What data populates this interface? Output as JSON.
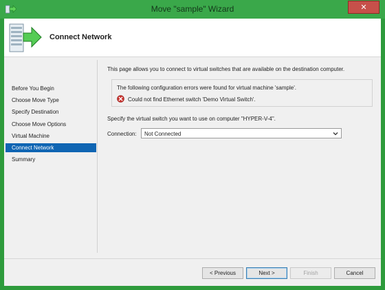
{
  "window": {
    "title": "Move \"sample\" Wizard",
    "close_label": "✕",
    "accent_color": "#3aa84a"
  },
  "header": {
    "title": "Connect Network",
    "icon": "wizard-server-arrow-icon"
  },
  "nav": {
    "items": [
      {
        "label": "Before You Begin",
        "active": false
      },
      {
        "label": "Choose Move Type",
        "active": false
      },
      {
        "label": "Specify Destination",
        "active": false
      },
      {
        "label": "Choose Move Options",
        "active": false
      },
      {
        "label": "Virtual Machine",
        "active": false
      },
      {
        "label": "Connect Network",
        "active": true
      },
      {
        "label": "Summary",
        "active": false
      }
    ],
    "selection_color": "#0f65b3"
  },
  "content": {
    "intro": "This page allows you to connect to virtual switches that are available on the destination computer.",
    "errors_heading": "The following configuration errors were found for virtual machine 'sample'.",
    "error_message": "Could not find Ethernet switch 'Demo Virtual Switch'.",
    "error_icon": "error-icon",
    "switch_prompt": "Specify the virtual switch you want to use on computer \"HYPER-V-4\".",
    "connection_label": "Connection:",
    "connection_value": "Not Connected"
  },
  "buttons": {
    "previous": "< Previous",
    "next": "Next >",
    "finish": "Finish",
    "cancel": "Cancel"
  }
}
